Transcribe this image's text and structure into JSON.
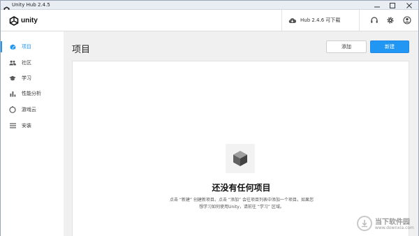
{
  "window": {
    "title": "Unity Hub 2.4.5"
  },
  "header": {
    "logo_text": "unity",
    "update_text": "Hub 2.4.6 可下载"
  },
  "sidebar": {
    "items": [
      {
        "label": "项目",
        "icon": "cube-icon",
        "active": true
      },
      {
        "label": "社区",
        "icon": "people-icon",
        "active": false
      },
      {
        "label": "学习",
        "icon": "graduation-cap-icon",
        "active": false
      },
      {
        "label": "性能分析",
        "icon": "bar-chart-icon",
        "active": false
      },
      {
        "label": "游戏云",
        "icon": "cloud-cube-icon",
        "active": false
      },
      {
        "label": "安装",
        "icon": "list-icon",
        "active": false
      }
    ]
  },
  "main": {
    "title": "项目",
    "add_label": "添加",
    "new_label": "新建",
    "empty_title": "还没有任何项目",
    "empty_desc": "点击 “新建” 创建新项目。点击 “添加” 会往项目列表中添加一个项目。如果您想学习如何使用Unity，请前往 “学习” 区域。"
  },
  "watermark": {
    "title": "当下软件园",
    "url": "www.downxia.com"
  },
  "colors": {
    "accent": "#2196f3",
    "background": "#f0f0f0",
    "panel": "#ffffff"
  }
}
